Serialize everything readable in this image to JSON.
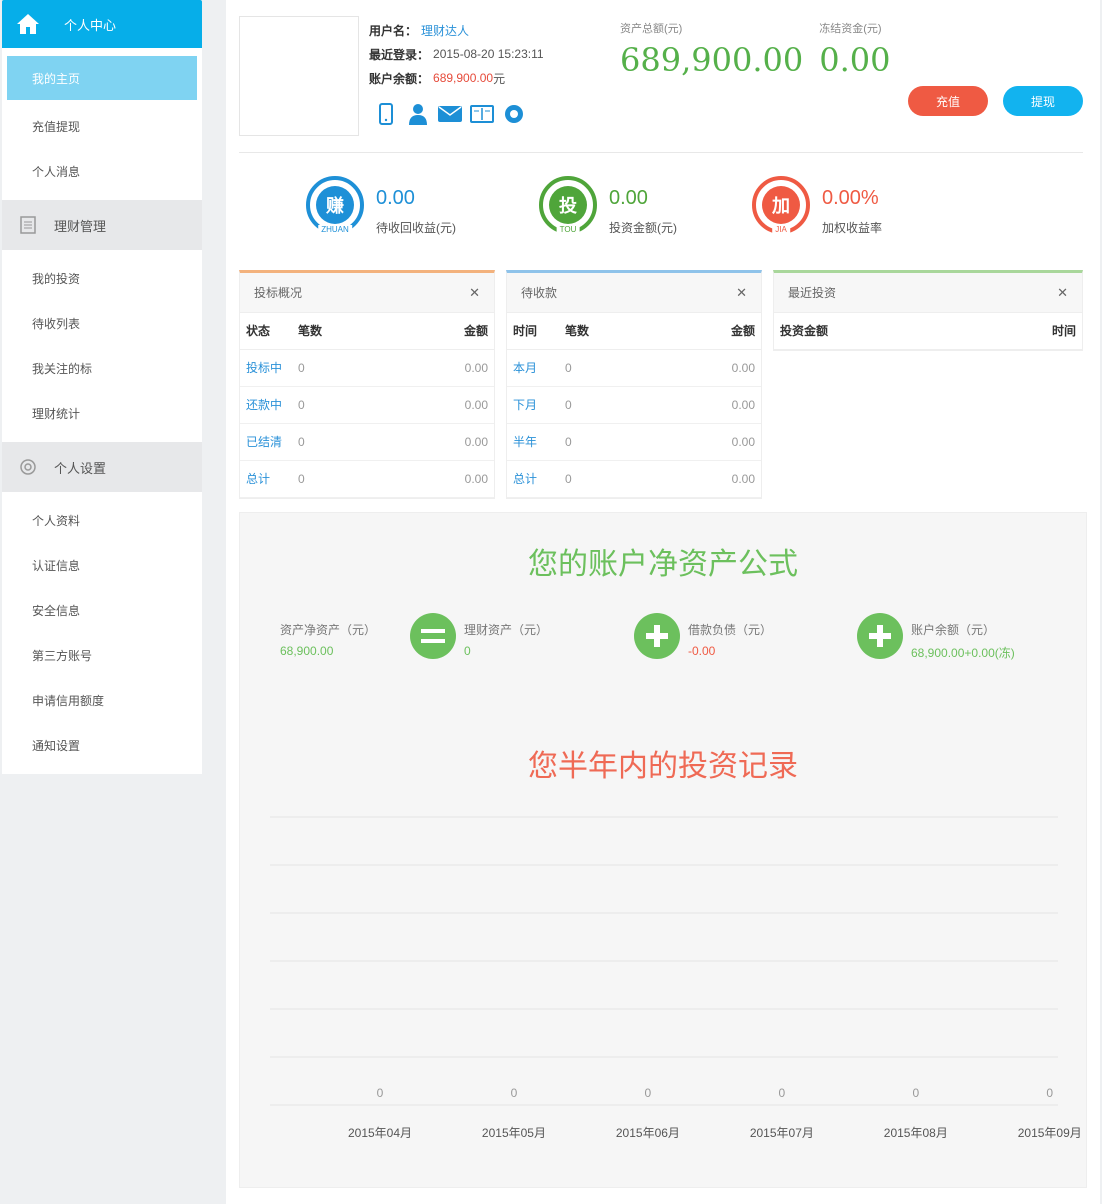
{
  "sidebar": {
    "header": "个人中心",
    "group1": [
      "我的主页",
      "充值提现",
      "个人消息"
    ],
    "section2": "理财管理",
    "group2": [
      "我的投资",
      "待收列表",
      "我关注的标",
      "理财统计"
    ],
    "section3": "个人设置",
    "group3": [
      "个人资料",
      "认证信息",
      "安全信息",
      "第三方账号",
      "申请信用额度",
      "通知设置"
    ]
  },
  "profile": {
    "username_label": "用户名：",
    "username": "理财达人",
    "last_login_label": "最近登录：",
    "last_login": "2015-08-20 15:23:11",
    "balance_label": "账户余额：",
    "balance": "689,900.00",
    "balance_unit": "元"
  },
  "assets": [
    {
      "label": "资产总额(元)",
      "value": "689,900.00"
    },
    {
      "label": "冻结资金(元)",
      "value": "0.00"
    }
  ],
  "actions": {
    "recharge": "充值",
    "withdraw": "提现"
  },
  "stats": [
    {
      "icon": "赚",
      "tag": "ZHUAN",
      "value": "0.00",
      "desc": "待收回收益(元)",
      "color": "#1e90d7"
    },
    {
      "icon": "投",
      "tag": "TOU",
      "value": "0.00",
      "desc": "投资金额(元)",
      "color": "#4fa53a"
    },
    {
      "icon": "加",
      "tag": "JIA",
      "value": "0.00%",
      "desc": "加权收益率",
      "color": "#ef5a43"
    }
  ],
  "panels": [
    {
      "title": "投标概况",
      "color": "#f3b27d",
      "headers": [
        "状态",
        "笔数",
        "金额"
      ],
      "rows": [
        [
          "投标中",
          "0",
          "0.00"
        ],
        [
          "还款中",
          "0",
          "0.00"
        ],
        [
          "已结清",
          "0",
          "0.00"
        ],
        [
          "总计",
          "0",
          "0.00"
        ]
      ]
    },
    {
      "title": "待收款",
      "color": "#8fc3ea",
      "headers": [
        "时间",
        "笔数",
        "金额"
      ],
      "rows": [
        [
          "本月",
          "0",
          "0.00"
        ],
        [
          "下月",
          "0",
          "0.00"
        ],
        [
          "半年",
          "0",
          "0.00"
        ],
        [
          "总计",
          "0",
          "0.00"
        ]
      ]
    },
    {
      "title": "最近投资",
      "color": "#a9d79b",
      "headers": [
        "投资金额",
        "时间"
      ],
      "rows": []
    }
  ],
  "formula": {
    "title": "您的账户净资产公式",
    "items": [
      {
        "label": "资产净资产（元）",
        "value": "68,900.00",
        "value_color": "#6cc05d"
      },
      {
        "label": "理财资产（元）",
        "value": "0",
        "value_color": "#6cc05d"
      },
      {
        "label": "借款负债（元）",
        "value": "-0.00",
        "value_color": "#ef5a43"
      },
      {
        "label": "账户余额（元）",
        "value": "68,900.00+0.00(冻)",
        "value_color": "#6cc05d"
      }
    ],
    "ops": [
      "=",
      "+",
      "+"
    ]
  },
  "chart_title": "您半年内的投资记录",
  "chart_data": {
    "type": "bar",
    "categories": [
      "2015年04月",
      "2015年05月",
      "2015年06月",
      "2015年07月",
      "2015年08月",
      "2015年09月"
    ],
    "values": [
      0,
      0,
      0,
      0,
      0,
      0
    ],
    "title": "您半年内的投资记录",
    "grid": true
  }
}
